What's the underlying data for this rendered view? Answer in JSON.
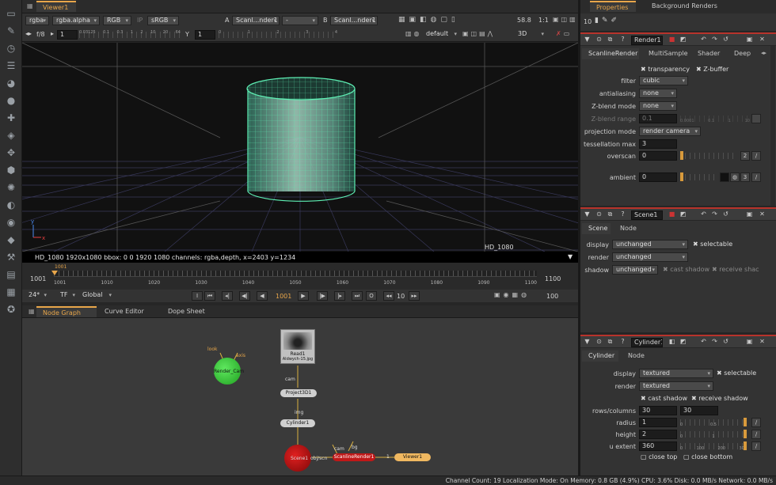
{
  "colors": {
    "accent": "#e8a64a",
    "wireframe": "#5ef0b4",
    "node_green": "#2fc42f",
    "node_red": "#b01010",
    "viewer_node": "#f0b860",
    "read_node": "#c0c0c0"
  },
  "viewer": {
    "tab": "Viewer1",
    "channels": "rgba",
    "alpha": "rgba.alpha",
    "display": "RGB",
    "ip": "IP",
    "lut": "sRGB",
    "a_label": "A",
    "a_node": "Scanl...nder1",
    "a_op": "-",
    "b_label": "B",
    "b_node": "Scanl...nder1",
    "zoom": "58.8",
    "ratio": "1:1",
    "fstop": "f/8",
    "gain": "1",
    "gamma_label": "Y",
    "gamma": "1",
    "cam_mode": "default",
    "view_mode": "3D",
    "format": "HD_1080",
    "info": "HD_1080 1920x1080  bbox: 0 0 1920 1080 channels: rgba,depth,  x=2403 y=1234",
    "gain_ticks": [
      "0.03125",
      "0.1",
      "0.3",
      "1",
      "2",
      "10",
      "20",
      "64"
    ],
    "gamma_ticks": [
      "0",
      "1",
      "2",
      "3",
      "4"
    ]
  },
  "timeline": {
    "start": "1001",
    "end": "1100",
    "current_marker": "1001",
    "ticks": [
      "1001",
      "1010",
      "1020",
      "1030",
      "1040",
      "1050",
      "1060",
      "1070",
      "1080",
      "1090",
      "1100"
    ],
    "fps": "24*",
    "tf": "TF",
    "scope": "Global",
    "frame": "1001",
    "step": "10",
    "end_field": "100",
    "i_btn": "I",
    "o_btn": "O"
  },
  "node_tabs": {
    "node_graph": "Node Graph",
    "curve_editor": "Curve Editor",
    "dope_sheet": "Dope Sheet"
  },
  "nodes": {
    "read": "Read1",
    "read_file": "Aldwych-15.jpg",
    "render_cam": "Render_Cam",
    "look": "look",
    "axis": "axis",
    "project": "Project3D1",
    "cam": "cam",
    "img": "img",
    "cylinder": "Cylinder1",
    "scene": "Scene1",
    "obj_scn": "obj/scn",
    "scanline": "ScanlineRender1",
    "cam2": "cam",
    "bg": "bg",
    "viewer": "Viewer1",
    "one": "1"
  },
  "properties": {
    "tab": "Properties",
    "tab2": "Background Renders",
    "max_panels": "10",
    "scanline": {
      "name": "Render1",
      "tabs": [
        "ScanlineRender",
        "MultiSample",
        "Shader",
        "Deep"
      ],
      "transparency": "transparency",
      "zbuffer": "Z-buffer",
      "filter_label": "filter",
      "filter": "cubic",
      "antialiasing_label": "antialiasing",
      "antialiasing": "none",
      "zblend_mode_label": "Z-blend mode",
      "zblend_mode": "none",
      "zblend_range_label": "Z-blend range",
      "zblend_range": "0.1",
      "zblend_ticks": [
        "0.0001",
        "0.1",
        "1",
        "10"
      ],
      "projection_label": "projection mode",
      "projection": "render camera",
      "tess_label": "tessellation max",
      "tess": "3",
      "overscan_label": "overscan",
      "overscan": "0",
      "overscan_btn": "2",
      "ambient_label": "ambient",
      "ambient": "0",
      "ambient_btn": "3"
    },
    "scene": {
      "name": "Scene1",
      "tabs": [
        "Scene",
        "Node"
      ],
      "display_label": "display",
      "display": "unchanged",
      "selectable": "selectable",
      "render_label": "render",
      "render": "unchanged",
      "shadow_label": "shadow",
      "shadow": "unchanged",
      "cast_shadow": "cast shadow",
      "receive_shadow": "receive shac"
    },
    "cylinder": {
      "name": "Cylinder1",
      "tabs": [
        "Cylinder",
        "Node"
      ],
      "display_label": "display",
      "display": "textured",
      "selectable": "selectable",
      "render_label": "render",
      "render": "textured",
      "cast_shadow": "cast shadow",
      "receive_shadow": "receive shadow",
      "rows_label": "rows/columns",
      "rows": "30",
      "columns": "30",
      "radius_label": "radius",
      "radius": "1",
      "radius_ticks": [
        "0",
        "0.5",
        "1"
      ],
      "height_label": "height",
      "height": "2",
      "height_ticks": [
        "0",
        "1",
        "2"
      ],
      "uext_label": "u extent",
      "uext": "360",
      "uext_ticks": [
        "0",
        "100",
        "200",
        "300"
      ],
      "close_top": "close top",
      "close_bottom": "close bottom"
    }
  },
  "status": "Channel Count: 19  Localization Mode: On  Memory: 0.8 GB (4.9%)  CPU: 3.6%  Disk: 0.0 MB/s  Network: 0.0 MB/s"
}
